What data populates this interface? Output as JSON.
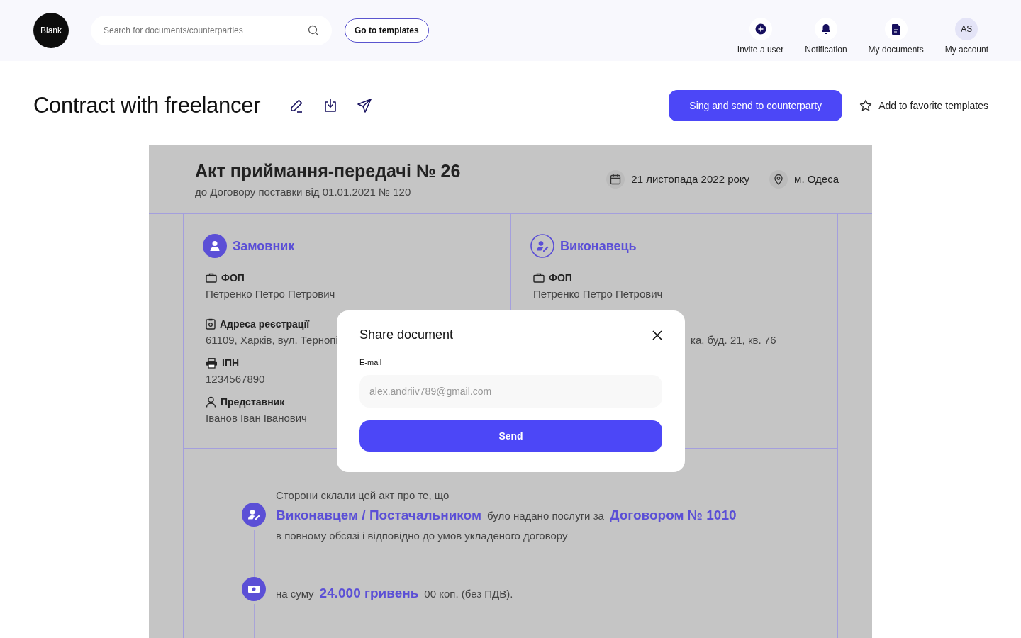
{
  "header": {
    "logo": "Blank",
    "search": {
      "placeholder": "Search for documents/counterparties"
    },
    "templates_button": "Go to templates",
    "nav": [
      {
        "kind": "invite",
        "label": "Invite a user"
      },
      {
        "kind": "notification",
        "label": "Notification"
      },
      {
        "kind": "documents",
        "label": "My documents"
      },
      {
        "kind": "account",
        "label": "My account",
        "initials": "AS"
      }
    ]
  },
  "title_bar": {
    "title": "Contract with freelancer",
    "sign_button": "Sing and send to counterparty",
    "favorite_label": "Add to favorite templates"
  },
  "document": {
    "title": "Акт приймання-передачі № 26",
    "subtitle": "до Договору поставки від 01.01.2021 № 120",
    "date": "21 листопада 2022 року",
    "city": "м. Одеса",
    "parties": [
      {
        "kind": "customer",
        "name": "Замовник",
        "fields": [
          {
            "kind": "type",
            "label": "ФОП",
            "value": "Петренко Петро Петрович"
          },
          {
            "kind": "address",
            "label": "Адреса реєстрації",
            "value": "61109, Харків, вул. Тернопі"
          },
          {
            "kind": "tax",
            "label": "ІПН",
            "value": "1234567890"
          },
          {
            "kind": "person",
            "label": "Представник",
            "value": "Іванов Іван Іванович"
          }
        ]
      },
      {
        "kind": "contractor",
        "name": "Виконавець",
        "fields": [
          {
            "kind": "type",
            "label": "ФОП",
            "value": "Петренко Петро Петрович"
          },
          {
            "kind": "address",
            "value": "ка, буд. 21, кв. 76"
          }
        ]
      }
    ],
    "statements": [
      {
        "kind": "person",
        "intro": "Сторони склали цей акт про те, що",
        "parts": [
          {
            "text": "Виконавцем / Постачальником",
            "emphasis": true
          },
          {
            "text": "було надано послуги за",
            "emphasis": false
          },
          {
            "text": "Договором № 1010",
            "emphasis": true
          }
        ],
        "note": "в повному обсязі і відповідно до умов укладеного договору"
      },
      {
        "kind": "money",
        "parts": [
          {
            "text": "на суму",
            "emphasis": false
          },
          {
            "text": "24.000 гривень",
            "emphasis": true
          },
          {
            "text": "00 коп. (без ПДВ).",
            "emphasis": false
          }
        ]
      }
    ]
  },
  "share_dialog": {
    "title": "Share document",
    "email_label": "E-mail",
    "email": {
      "placeholder": "alex.andriiv789@gmail.com"
    },
    "send_button": "Send"
  }
}
